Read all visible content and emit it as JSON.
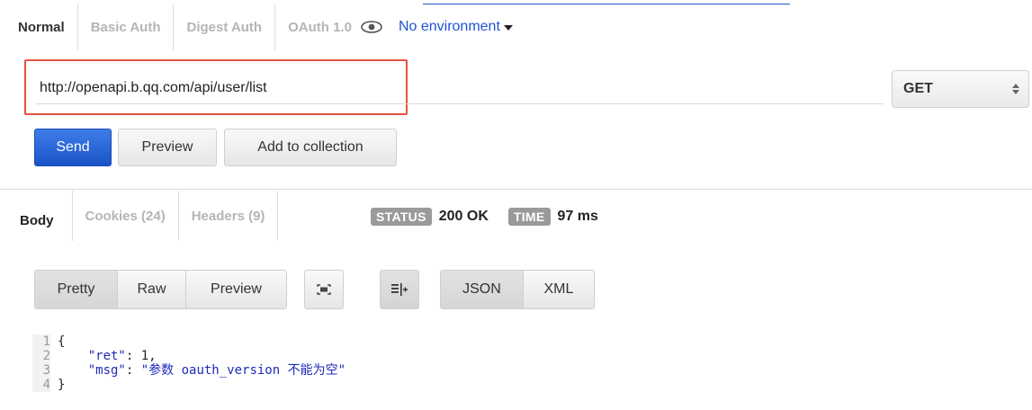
{
  "auth_tabs": [
    {
      "label": "Normal",
      "active": true
    },
    {
      "label": "Basic Auth",
      "active": false
    },
    {
      "label": "Digest Auth",
      "active": false
    },
    {
      "label": "OAuth 1.0",
      "active": false
    }
  ],
  "environment": {
    "icon": "eye-icon",
    "label": "No environment"
  },
  "request": {
    "url": "http://openapi.b.qq.com/api/user/list",
    "method": "GET"
  },
  "actions": {
    "send": "Send",
    "preview": "Preview",
    "add_to_collection": "Add to collection"
  },
  "response_tabs": [
    {
      "label": "Body",
      "active": true
    },
    {
      "label": "Cookies (24)",
      "active": false
    },
    {
      "label": "Headers (9)",
      "active": false
    }
  ],
  "status": {
    "status_label": "STATUS",
    "status_value": "200 OK",
    "time_label": "TIME",
    "time_value": "97 ms"
  },
  "view_modes": [
    "Pretty",
    "Raw",
    "Preview"
  ],
  "formats": [
    "JSON",
    "XML"
  ],
  "icons": {
    "fullscreen": "fullscreen-icon",
    "wrap": "wrap-lines-icon"
  },
  "body_lines": [
    {
      "n": "1",
      "text": "{"
    },
    {
      "n": "2",
      "key": "\"ret\"",
      "sep": ": ",
      "value": "1,"
    },
    {
      "n": "3",
      "key": "\"msg\"",
      "sep": ": ",
      "value": "\"参数 oauth_version 不能为空\""
    },
    {
      "n": "4",
      "text": "}"
    }
  ],
  "colors": {
    "highlight": "#e2533f",
    "send": "#1a53c7",
    "link": "#1d52d8",
    "json_string": "#1d2bb8"
  }
}
